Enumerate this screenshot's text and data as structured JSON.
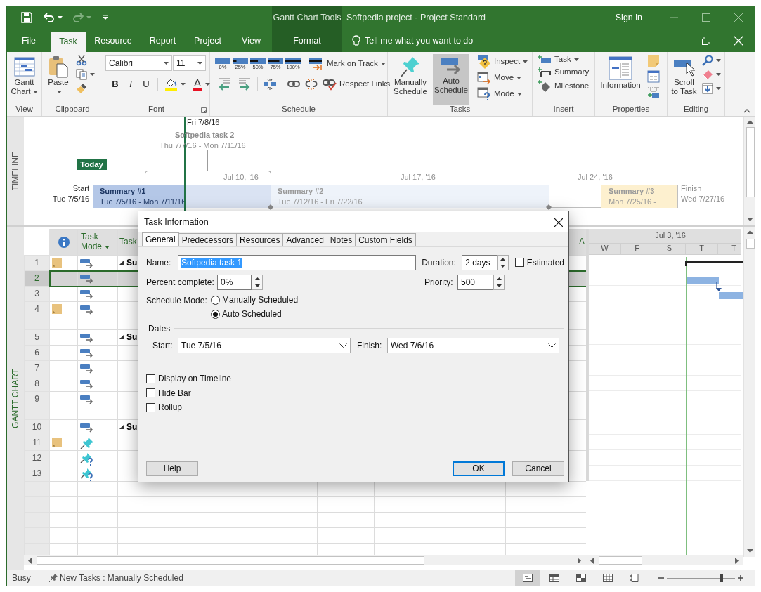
{
  "title_bar": {
    "context_group": "Gantt Chart Tools",
    "title": "Softpedia project - Project Standard",
    "sign_in": "Sign in"
  },
  "tabs": [
    {
      "label": "File",
      "selected": false,
      "kind": "normal"
    },
    {
      "label": "Task",
      "selected": true,
      "kind": "normal"
    },
    {
      "label": "Resource",
      "selected": false,
      "kind": "normal"
    },
    {
      "label": "Report",
      "selected": false,
      "kind": "normal"
    },
    {
      "label": "Project",
      "selected": false,
      "kind": "normal"
    },
    {
      "label": "View",
      "selected": false,
      "kind": "normal"
    },
    {
      "label": "Format",
      "selected": false,
      "kind": "context"
    }
  ],
  "tell_me": {
    "placeholder": "Tell me what you want to do"
  },
  "ribbon_groups": [
    {
      "label": "View",
      "buttons": [
        {
          "label": "Gantt Chart",
          "dropdown": true
        }
      ]
    },
    {
      "label": "Clipboard",
      "buttons": [
        {
          "label": "Paste",
          "dropdown": true
        },
        {
          "dropdown": false
        },
        {
          "dropdown": true
        },
        {
          "dropdown": false
        }
      ]
    },
    {
      "label": "Font",
      "launcher": true,
      "font_name": "Calibri",
      "font_size": "11",
      "buttons": [
        {
          "label": "B",
          "dropdown": false
        },
        {
          "label": "I",
          "dropdown": false
        },
        {
          "label": "U",
          "dropdown": false
        },
        {
          "dropdown": true
        },
        {
          "label": "A",
          "dropdown": true
        }
      ]
    },
    {
      "label": "Schedule",
      "buttons": [
        {
          "label": "0%"
        },
        {
          "label": "25%"
        },
        {
          "label": "50%"
        },
        {
          "label": "75%"
        },
        {
          "label": "100%"
        },
        {
          "label": "Mark on Track",
          "dropdown": true
        },
        {
          "dropdown": false
        },
        {
          "dropdown": false
        },
        {
          "dropdown": false
        },
        {
          "dropdown": false
        },
        {
          "dropdown": false
        },
        {
          "label": "Respect Links",
          "dropdown": false
        }
      ]
    },
    {
      "label": "Tasks",
      "buttons": [
        {
          "label": "Manually Schedule",
          "selected": false
        },
        {
          "label": "Auto Schedule",
          "selected": true
        },
        {
          "label": "Inspect",
          "dropdown": true
        },
        {
          "label": "Move",
          "dropdown": true
        },
        {
          "label": "Mode",
          "dropdown": true
        }
      ]
    },
    {
      "label": "Insert",
      "buttons": [
        {
          "label": "Task",
          "dropdown": true
        },
        {
          "label": "Summary",
          "dropdown": false
        },
        {
          "label": "Milestone",
          "dropdown": false
        }
      ]
    },
    {
      "label": "Properties",
      "buttons": [
        {
          "label": "Information",
          "dropdown": false
        },
        {
          "dropdown": false
        },
        {
          "dropdown": false
        },
        {
          "dropdown": false
        }
      ]
    },
    {
      "label": "Editing",
      "buttons": [
        {
          "label": "Scroll to Task",
          "dropdown": false
        },
        {
          "dropdown": true
        },
        {
          "dropdown": true
        },
        {
          "dropdown": true
        }
      ]
    }
  ],
  "timeline": {
    "label": "TIMELINE",
    "today": "Today",
    "current_date": "Fri 7/8/16",
    "callout": {
      "name": "Softpedia task 2",
      "dates": "Thu 7/7/16 - Mon 7/11/16"
    },
    "start": {
      "label": "Start",
      "date": "Tue 7/5/16"
    },
    "finish": {
      "label": "Finish",
      "date": "Wed 7/27/16"
    },
    "ticks": [
      "Jul 10, '16",
      "Jul 17, '16",
      "Jul 24, '16"
    ],
    "bars": [
      {
        "name": "Summary #1",
        "dates": "Tue 7/5/16 - Mon 7/11/16",
        "color": "#dae3f3",
        "selected": true,
        "level": 0.52
      },
      {
        "name": "Summary #2",
        "dates": "Tue 7/12/16 - Fri 7/22/16",
        "color": "#eef3fa",
        "selected": false
      },
      {
        "name": "Summary #3",
        "dates": "Mon 7/25/16 -",
        "color": "#fdf0cf",
        "selected": false
      }
    ]
  },
  "gantt": {
    "label": "GANTT CHART",
    "columns": [
      {
        "kind": "info"
      },
      {
        "kind": "text",
        "label": "Task Mode",
        "dropdown": true
      },
      {
        "kind": "text",
        "label": "Task",
        "dropdown": false
      },
      {
        "kind": "text",
        "label": "A",
        "dropdown": false
      }
    ],
    "rows": [
      {
        "id": "1",
        "note": true,
        "kind": "auto",
        "summary": true,
        "name": "Su",
        "selected": false,
        "wrapped": false
      },
      {
        "id": "2",
        "note": false,
        "kind": "auto",
        "summary": false,
        "selected": true,
        "wrapped": false
      },
      {
        "id": "3",
        "note": false,
        "kind": "auto",
        "summary": false,
        "selected": false,
        "wrapped": false
      },
      {
        "id": "4",
        "note": true,
        "kind": "auto",
        "summary": false,
        "selected": false,
        "wrapped": true
      },
      {
        "id": "5",
        "note": false,
        "kind": "auto",
        "summary": true,
        "name": "Su",
        "selected": false,
        "wrapped": false
      },
      {
        "id": "6",
        "note": false,
        "kind": "auto",
        "summary": false,
        "selected": false,
        "wrapped": false
      },
      {
        "id": "7",
        "note": false,
        "kind": "auto",
        "summary": false,
        "selected": false,
        "wrapped": false
      },
      {
        "id": "8",
        "note": false,
        "kind": "auto",
        "summary": false,
        "selected": false,
        "wrapped": false
      },
      {
        "id": "9",
        "note": false,
        "kind": "auto",
        "summary": false,
        "selected": false,
        "wrapped": true
      },
      {
        "id": "10",
        "note": false,
        "kind": "auto",
        "summary": true,
        "name": "Su",
        "selected": false,
        "wrapped": false
      },
      {
        "id": "11",
        "note": true,
        "kind": "manual",
        "summary": false,
        "selected": false,
        "wrapped": false
      },
      {
        "id": "12",
        "note": false,
        "kind": "manual_incomplete",
        "summary": false,
        "selected": false,
        "wrapped": false
      },
      {
        "id": "13",
        "note": false,
        "kind": "manual_incomplete",
        "summary": false,
        "selected": false,
        "wrapped": false
      }
    ],
    "timescale": {
      "week": "Jul 3, '16",
      "days": [
        "W",
        "F",
        "S",
        "T",
        "T"
      ]
    }
  },
  "dialog": {
    "title": "Task Information",
    "tabs": [
      {
        "label": "General",
        "selected": true
      },
      {
        "label": "Predecessors",
        "selected": false
      },
      {
        "label": "Resources",
        "selected": false
      },
      {
        "label": "Advanced",
        "selected": false
      },
      {
        "label": "Notes",
        "selected": false
      },
      {
        "label": "Custom Fields",
        "selected": false
      }
    ],
    "name": {
      "label": "Name:",
      "value": "Softpedia task 1",
      "highlighted": true
    },
    "duration": {
      "label": "Duration:",
      "value": "2 days"
    },
    "estimated": {
      "label": "Estimated",
      "checked": false
    },
    "percent_complete": {
      "label": "Percent complete:",
      "value": "0%"
    },
    "priority": {
      "label": "Priority:",
      "value": "500"
    },
    "schedule_mode": {
      "label": "Schedule Mode:",
      "options": [
        {
          "label": "Manually Scheduled",
          "selected": false
        },
        {
          "label": "Auto Scheduled",
          "selected": true
        }
      ]
    },
    "dates": {
      "label": "Dates",
      "start": {
        "label": "Start:",
        "value": "Tue 7/5/16"
      },
      "finish": {
        "label": "Finish:",
        "value": "Wed 7/6/16"
      }
    },
    "options": [
      {
        "label": "Display on Timeline",
        "checked": false
      },
      {
        "label": "Hide Bar",
        "checked": false
      },
      {
        "label": "Rollup",
        "checked": false
      }
    ],
    "buttons": [
      {
        "label": "Help",
        "kind": "normal"
      },
      {
        "label": "OK",
        "kind": "default"
      },
      {
        "label": "Cancel",
        "kind": "normal"
      }
    ]
  },
  "status_bar": {
    "status": "Busy",
    "new_tasks": "New Tasks : Manually Scheduled",
    "views": [
      {
        "selected": true
      },
      {
        "selected": false
      },
      {
        "selected": false
      },
      {
        "selected": false
      },
      {
        "selected": false
      }
    ],
    "zoom": {
      "level": 0.8
    }
  }
}
